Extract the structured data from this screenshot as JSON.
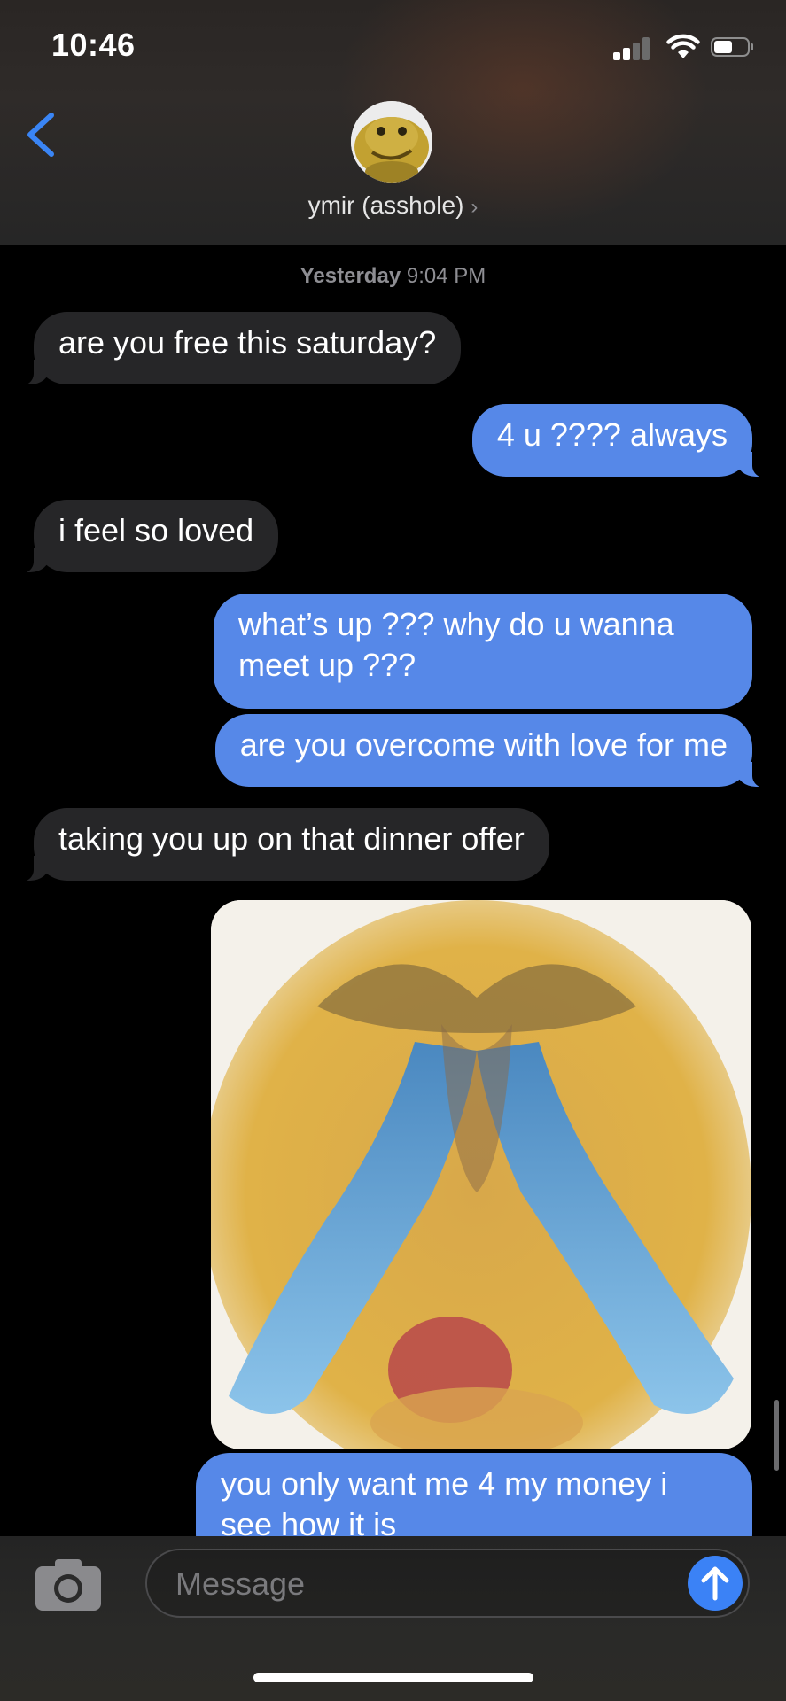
{
  "status_bar": {
    "time": "10:46"
  },
  "header": {
    "contact_name": "ymir (asshole)",
    "name_chevron": "›"
  },
  "timestamp": {
    "day": "Yesterday",
    "time": "9:04 PM"
  },
  "messages": [
    {
      "direction": "incoming",
      "text": "are you free this saturday?"
    },
    {
      "direction": "outgoing",
      "text": "4 u ???? always"
    },
    {
      "direction": "incoming",
      "text": "i feel so loved"
    },
    {
      "direction": "outgoing",
      "text": "what’s up ??? why do u wanna meet up ???"
    },
    {
      "direction": "outgoing",
      "text": "are you overcome with love for me"
    },
    {
      "direction": "incoming",
      "text": "taking you up on that dinner offer"
    },
    {
      "direction": "incoming",
      "type": "image",
      "icon": "crying-emoji-image"
    },
    {
      "direction": "outgoing",
      "text": "you only want me 4 my money i see how it is"
    }
  ],
  "input_bar": {
    "placeholder": "Message",
    "camera_icon": "camera-icon",
    "send_icon": "arrow-up-icon"
  },
  "colors": {
    "outgoing_bubble": "#5688e8",
    "incoming_bubble": "#262628",
    "accent": "#3b82f6"
  }
}
